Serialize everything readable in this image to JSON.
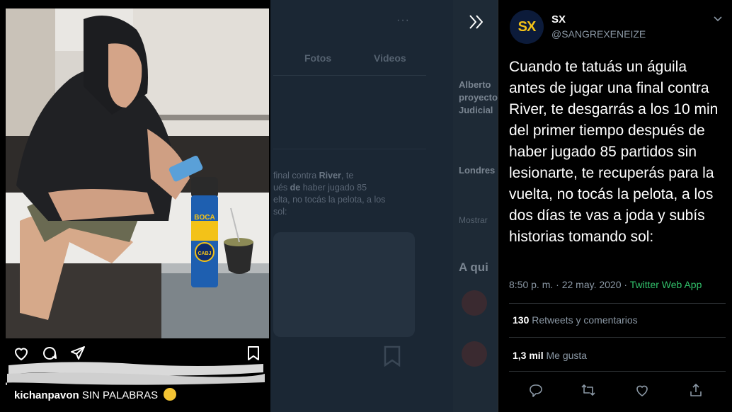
{
  "background": {
    "tabs": [
      "Fotos",
      "Videos"
    ],
    "tweet_text_pre": "final contra ",
    "tweet_text_bold1": "River",
    "tweet_text_mid": ", te\n",
    "tweet_text_2": "ués ",
    "tweet_text_bold2": "de",
    "tweet_text_3": " haber jugado 85\nelta, no tocás la pelota, a los\n sol:",
    "right_items": [
      "Alberto",
      "proyecto",
      "Judicial",
      "Londres",
      "Mostrar",
      "A qui"
    ]
  },
  "instagram": {
    "username": "kichanpavon",
    "caption": "SIN PALABRAS",
    "icons": [
      "heart-icon",
      "comment-icon",
      "share-icon",
      "bookmark-icon"
    ],
    "thermos_text": "BOCA",
    "thermos_logo": "CABJ"
  },
  "tweet": {
    "avatar_text": "SX",
    "name": "SX",
    "handle": "@SANGREXENEIZE",
    "text": "Cuando te tatuás un águila antes de jugar una final contra River, te desgarrás a los 10 min del primer tiempo después de haber jugado 85 partidos sin lesionarte, te recuperás para la vuelta, no tocás la pelota, a los dos días te vas a joda y subís historias tomando sol:",
    "time": "8:50 p. m. · 22 may. 2020 · ",
    "source": "Twitter Web App",
    "retweets_count": "130",
    "retweets_label": "Retweets y comentarios",
    "likes_count": "1,3 mil",
    "likes_label": "Me gusta",
    "colors": {
      "accent_green": "#32c16b",
      "secondary_text": "#8b98a5"
    }
  }
}
